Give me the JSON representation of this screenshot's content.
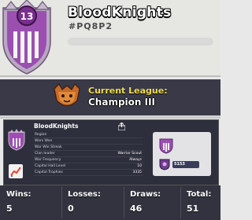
{
  "clan": {
    "name": "BloodKnights",
    "tag": "#PQ8P2",
    "level": "13",
    "badge_color": "#9b4fb0"
  },
  "league": {
    "label": "Current League:",
    "name": "Champion III",
    "icon": "champion-league-icon"
  },
  "info_card": {
    "name": "BloodKnights",
    "rows": [
      {
        "key": "Region",
        "value": ""
      },
      {
        "key": "Wars Won",
        "value": ""
      },
      {
        "key": "War Win Streak",
        "value": ""
      },
      {
        "key": "Clan leader",
        "value": "Warrior Scout"
      },
      {
        "key": "War Frequency",
        "value": "Always"
      },
      {
        "key": "Capital Hall Level",
        "value": "10"
      },
      {
        "key": "Capital Trophies",
        "value": "3335"
      }
    ],
    "war_score": "5153"
  },
  "stats": [
    {
      "label": "Wins:",
      "value": "5"
    },
    {
      "label": "Losses:",
      "value": "0"
    },
    {
      "label": "Draws:",
      "value": "46"
    },
    {
      "label": "Total:",
      "value": "51"
    }
  ]
}
